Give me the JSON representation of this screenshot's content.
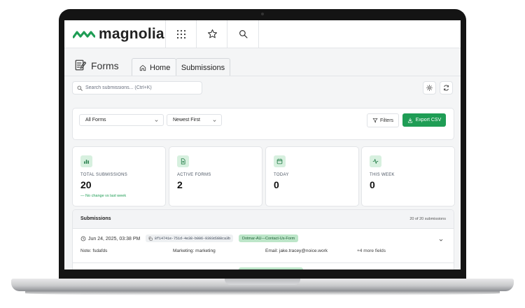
{
  "app": {
    "brand": "magnolia",
    "brand_color": "#1f9d55",
    "top_icons": [
      "grid-icon",
      "star-icon",
      "search-icon"
    ]
  },
  "header": {
    "title": "Forms",
    "tabs": [
      {
        "label": "Home",
        "icon": "home-icon"
      },
      {
        "label": "Submissions",
        "active": true
      }
    ]
  },
  "toolbar": {
    "search_placeholder": "Search submissions... (Ctrl+K)",
    "icons": [
      "sun-icon",
      "refresh-icon"
    ]
  },
  "filters": {
    "form_select": "All Forms",
    "sort_select": "Newest First",
    "filters_label": "Filters",
    "export_label": "Export CSV"
  },
  "stats": [
    {
      "label": "TOTAL SUBMISSIONS",
      "value": "20",
      "note": "— No change vs last week"
    },
    {
      "label": "ACTIVE FORMS",
      "value": "2"
    },
    {
      "label": "TODAY",
      "value": "0"
    },
    {
      "label": "THIS WEEK",
      "value": "0"
    }
  ],
  "submissions": {
    "title": "Submissions",
    "count": "20 of 20 submissions",
    "rows": [
      {
        "date": "Jun 24, 2025, 03:38 PM",
        "id": "8f14741e-751d-4e38-b006-9393d388ca3b",
        "form": "Dotmar-AU---Contact-Us-Form",
        "fields": [
          {
            "key": "Note:",
            "value": "fsdafds"
          },
          {
            "key": "Marketing:",
            "value": "marketing"
          },
          {
            "key": "Email:",
            "value": "jake.tracey@noice.work"
          }
        ],
        "more": "+4 more fields"
      }
    ]
  }
}
